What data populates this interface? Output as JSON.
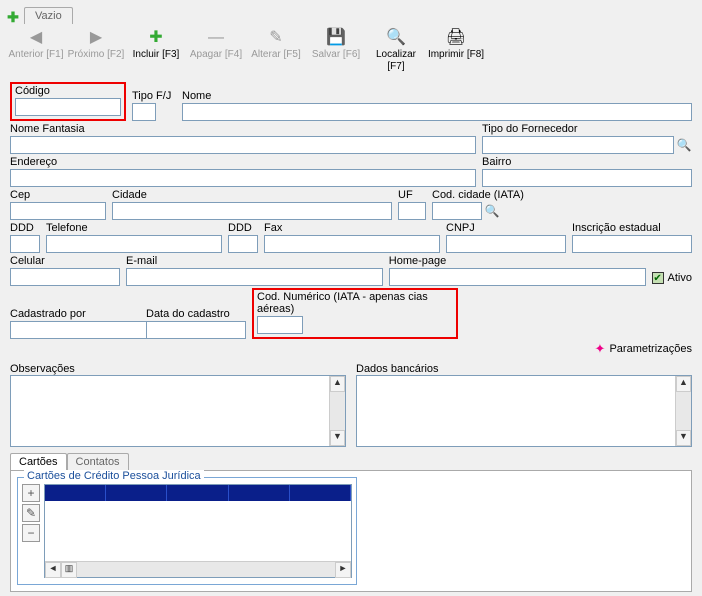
{
  "main_tab": "Vazio",
  "toolbar": {
    "anterior": "Anterior [F1]",
    "proximo": "Próximo [F2]",
    "incluir": "Incluir [F3]",
    "apagar": "Apagar [F4]",
    "alterar": "Alterar [F5]",
    "salvar": "Salvar [F6]",
    "localizar": "Localizar [F7]",
    "imprimir": "Imprimir [F8]"
  },
  "labels": {
    "codigo": "Código",
    "tipofj": "Tipo F/J",
    "nome": "Nome",
    "nome_fantasia": "Nome Fantasia",
    "tipo_fornecedor": "Tipo do Fornecedor",
    "endereco": "Endereço",
    "bairro": "Bairro",
    "cep": "Cep",
    "cidade": "Cidade",
    "uf": "UF",
    "cod_cidade_iata": "Cod. cidade (IATA)",
    "ddd": "DDD",
    "telefone": "Telefone",
    "fax": "Fax",
    "cnpj": "CNPJ",
    "inscricao_estadual": "Inscrição estadual",
    "celular": "Celular",
    "email": "E-mail",
    "homepage": "Home-page",
    "ativo": "Ativo",
    "cadastrado_por": "Cadastrado por",
    "data_cadastro": "Data do cadastro",
    "cod_numerico_iata": "Cod. Numérico (IATA - apenas cias aéreas)",
    "parametrizacoes": "Parametrizações",
    "observacoes": "Observações",
    "dados_bancarios": "Dados bancários"
  },
  "values": {
    "codigo": "",
    "tipofj": "",
    "nome": "",
    "nome_fantasia": "",
    "tipo_fornecedor": "",
    "endereco": "",
    "bairro": "",
    "cep": "",
    "cidade": "",
    "uf": "",
    "cod_cidade_iata": "",
    "ddd1": "",
    "telefone": "",
    "ddd2": "",
    "fax": "",
    "cnpj": "",
    "inscricao_estadual": "",
    "celular": "",
    "email": "",
    "homepage": "",
    "cadastrado_por": "",
    "data_cadastro": "",
    "cod_numerico_iata": "",
    "observacoes": "",
    "dados_bancarios": ""
  },
  "bottom_tabs": {
    "cartoes": "Cartões",
    "contatos": "Contatos"
  },
  "groupbox": {
    "title": "Cartões de Crédito Pessoa Jurídica"
  }
}
